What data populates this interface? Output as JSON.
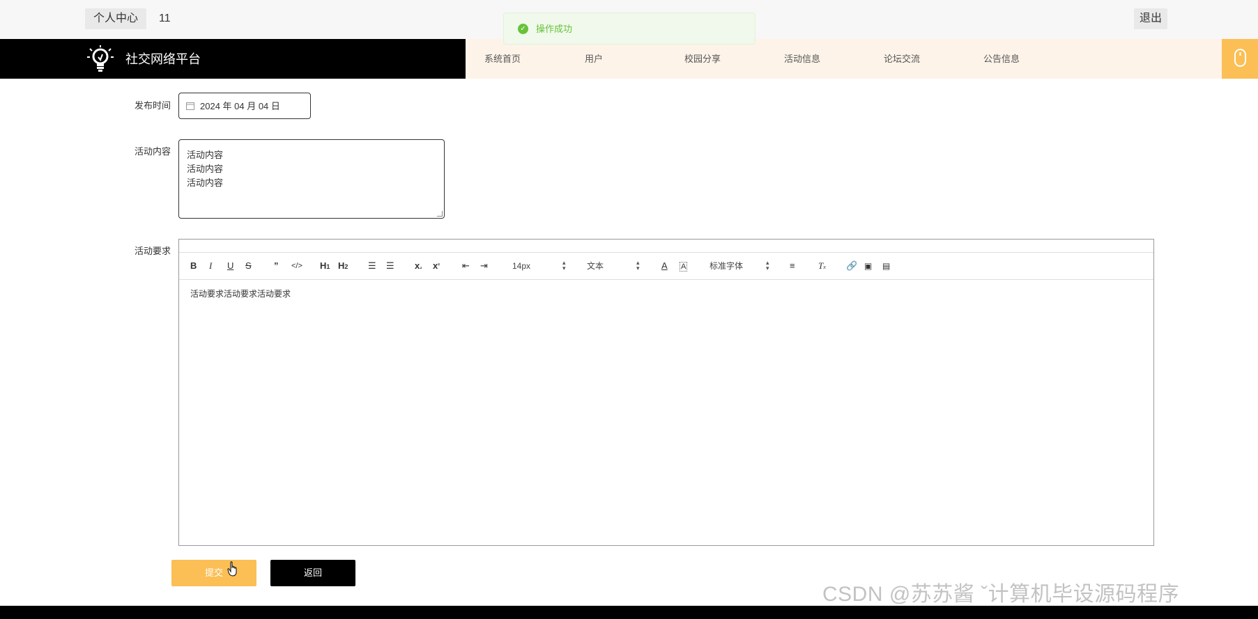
{
  "topbar": {
    "user_center": "个人中心",
    "username": "11",
    "logout": "退出"
  },
  "toast": {
    "icon": "check-circle-icon",
    "message": "操作成功",
    "color": "#67c23a"
  },
  "nav": {
    "brand": "社交网络平台",
    "items": [
      "系统首页",
      "用户",
      "校园分享",
      "活动信息",
      "论坛交流",
      "公告信息"
    ],
    "accent": "#fbbf55"
  },
  "form": {
    "publish_time_label": "发布时间",
    "publish_time_value": "2024 年 04 月 04 日",
    "content_label": "活动内容",
    "content_lines": [
      "活动内容",
      "活动内容",
      "活动内容"
    ],
    "requirement_label": "活动要求",
    "requirement_text": "活动要求活动要求活动要求"
  },
  "toolbar": {
    "font_size": "14px",
    "heading": "文本",
    "font_family": "标准字体"
  },
  "buttons": {
    "submit": "提交",
    "back": "返回"
  },
  "watermark": "CSDN @苏苏酱    ˇ计算机毕设源码程序"
}
